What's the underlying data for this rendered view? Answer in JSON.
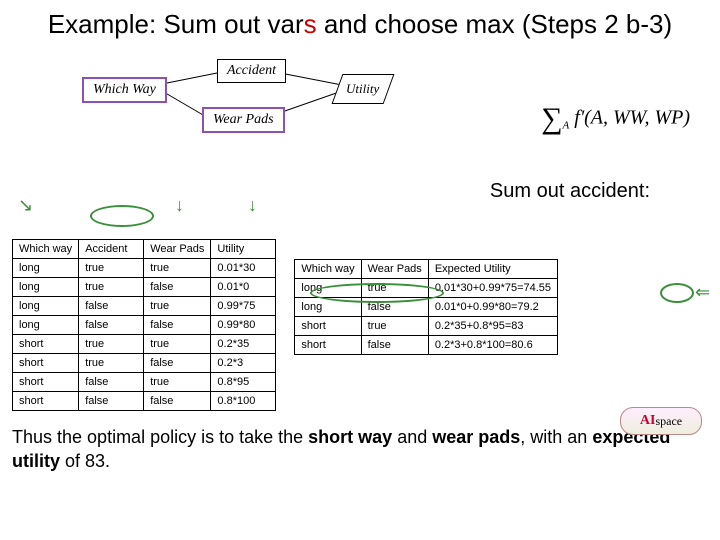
{
  "title_prefix": "Example: Sum out var",
  "title_red": "s",
  "title_suffix": " and choose max (Steps 2 b-3)",
  "nodes": {
    "accident": "Accident",
    "which_way": "Which Way",
    "wear_pads": "Wear Pads",
    "utility": "Utility"
  },
  "formula": {
    "sum_over": "A",
    "fn": "f'(A, WW, WP)"
  },
  "sumout_label": "Sum out accident:",
  "table1": {
    "headers": [
      "Which way",
      "Accident",
      "Wear Pads",
      "Utility"
    ],
    "rows": [
      [
        "long",
        "true",
        "true",
        "0.01*30"
      ],
      [
        "long",
        "true",
        "false",
        "0.01*0"
      ],
      [
        "long",
        "false",
        "true",
        "0.99*75"
      ],
      [
        "long",
        "false",
        "false",
        "0.99*80"
      ],
      [
        "short",
        "true",
        "true",
        "0.2*35"
      ],
      [
        "short",
        "true",
        "false",
        "0.2*3"
      ],
      [
        "short",
        "false",
        "true",
        "0.8*95"
      ],
      [
        "short",
        "false",
        "false",
        "0.8*100"
      ]
    ]
  },
  "table2": {
    "headers": [
      "Which way",
      "Wear Pads",
      "Expected Utility"
    ],
    "rows": [
      [
        "long",
        "true",
        "0.01*30+0.99*75=74.55"
      ],
      [
        "long",
        "false",
        "0.01*0+0.99*80=79.2"
      ],
      [
        "short",
        "true",
        "0.2*35+0.8*95=83"
      ],
      [
        "short",
        "false",
        "0.2*3+0.8*100=80.6"
      ]
    ]
  },
  "conclusion": {
    "prefix": "Thus the optimal policy is to take the ",
    "b1": "short way",
    "mid1": " and ",
    "b2": "wear pads",
    "mid2": ", with an ",
    "b3": "expected utility",
    "suffix": " of 83."
  },
  "logo": {
    "a": "AI",
    "rest": "space"
  }
}
